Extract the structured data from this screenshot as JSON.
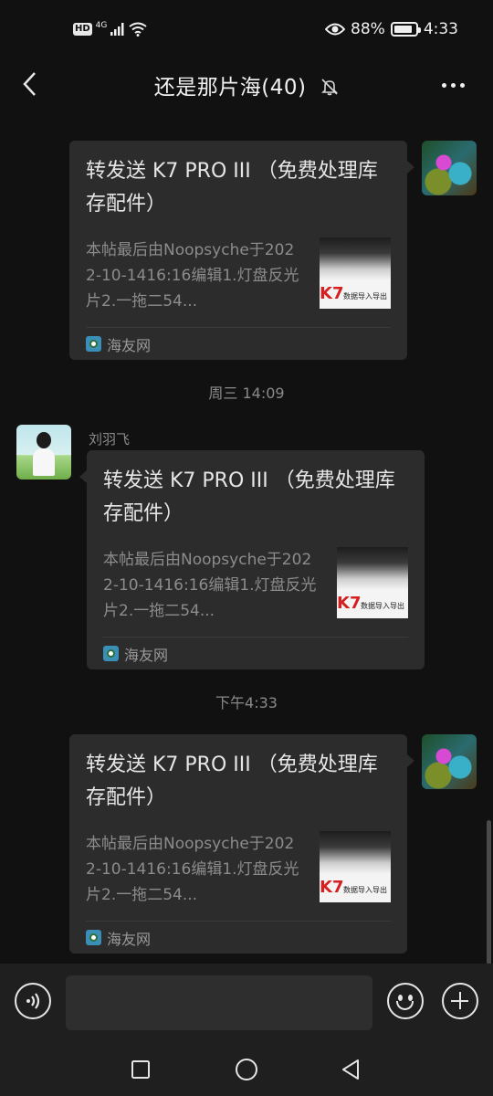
{
  "status_bar": {
    "hd": "HD",
    "network": "4G",
    "battery_level": 0.88,
    "battery_text": "88%",
    "time": "4:33"
  },
  "header": {
    "title": "还是那片海(40)",
    "muted": true
  },
  "messages": [
    {
      "side": "right",
      "link_title": "转发送 K7 PRO III （免费处理库存配件）",
      "link_desc": "本帖最后由Noopsyche于2022-10-1416:16编辑1.灯盘反光片2.一拖二54...",
      "source": "海友网",
      "thumb_brand": "K7",
      "thumb_caption": "数据导入导出"
    },
    {
      "side": "left",
      "sender": "刘羽飞",
      "link_title": "转发送 K7 PRO III （免费处理库存配件）",
      "link_desc": "本帖最后由Noopsyche于2022-10-1416:16编辑1.灯盘反光片2.一拖二54...",
      "source": "海友网",
      "thumb_brand": "K7",
      "thumb_caption": "数据导入导出"
    },
    {
      "side": "right",
      "link_title": "转发送 K7 PRO III （免费处理库存配件）",
      "link_desc": "本帖最后由Noopsyche于2022-10-1416:16编辑1.灯盘反光片2.一拖二54...",
      "source": "海友网",
      "thumb_brand": "K7",
      "thumb_caption": "数据导入导出"
    }
  ],
  "timestamps": [
    "周三 14:09",
    "下午4:33"
  ],
  "input": {
    "value": "",
    "placeholder": ""
  },
  "colors": {
    "background": "#111111",
    "bubble": "#2c2c2c",
    "muted_text": "#8c8c8c"
  },
  "icons": {
    "back": "back-arrow-icon",
    "mute": "bell-off-icon",
    "more": "more-dots-icon",
    "voice": "voice-icon",
    "emoji": "emoji-icon",
    "plus": "plus-icon",
    "nav_square": "recent-apps-icon",
    "nav_circle": "home-icon",
    "nav_triangle": "back-nav-icon"
  }
}
